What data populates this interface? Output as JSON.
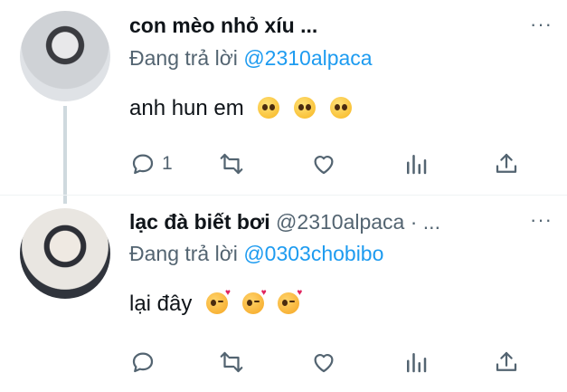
{
  "tweets": [
    {
      "name": "con mèo nhỏ xíu ...",
      "handle": "",
      "more": "···",
      "reply_prefix": "Đang trả lời ",
      "reply_to": "@2310alpaca",
      "text": "anh hun em",
      "emoji": [
        "pleading-face",
        "pleading-face",
        "pleading-face"
      ],
      "reply_count": "1",
      "retweet_count": "",
      "like_count": ""
    },
    {
      "name": "lạc đà biết bơi",
      "handle": " @2310alpaca · ...",
      "more": "···",
      "reply_prefix": "Đang trả lời ",
      "reply_to": "@0303chobibo",
      "text": "lại đây",
      "emoji": [
        "kiss-face",
        "kiss-face",
        "kiss-face"
      ],
      "reply_count": "",
      "retweet_count": "",
      "like_count": ""
    }
  ],
  "colors": {
    "text": "#0f1419",
    "secondary": "#536471",
    "link": "#1d9bf0",
    "thread_line": "#cfd9de"
  }
}
